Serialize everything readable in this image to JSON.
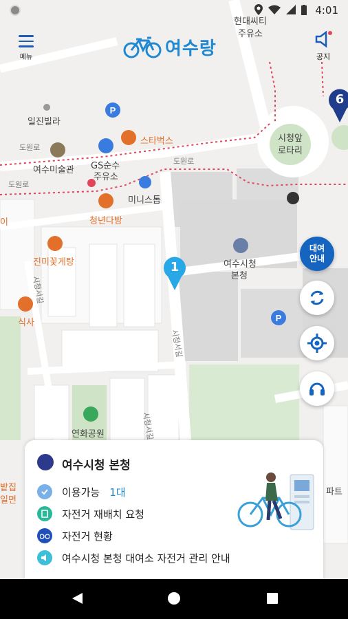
{
  "status_bar": {
    "time": "4:01"
  },
  "header": {
    "menu_label": "메뉴",
    "logo_text": "여수랑",
    "notice_label": "공지"
  },
  "map": {
    "labels": [
      {
        "id": "hyundai",
        "text": "현대씨티"
      },
      {
        "id": "juyuso1",
        "text": "주유소"
      },
      {
        "id": "ilgin",
        "text": "일진빌라"
      },
      {
        "id": "dowonro1",
        "text": "도원로"
      },
      {
        "id": "starbucks",
        "text": "스타벅스"
      },
      {
        "id": "yeosu-art",
        "text": "여수미술관"
      },
      {
        "id": "gs1",
        "text": "GS순수"
      },
      {
        "id": "gs2",
        "text": "주유소"
      },
      {
        "id": "dowonro2",
        "text": "도원로"
      },
      {
        "id": "dowonro3",
        "text": "도원로"
      },
      {
        "id": "ministop",
        "text": "미니스톱"
      },
      {
        "id": "cheongnyeon",
        "text": "청년다방"
      },
      {
        "id": "jinmi",
        "text": "진미꽃게탕"
      },
      {
        "id": "sikan",
        "text": "식사"
      },
      {
        "id": "cityhall",
        "text": "여수시청"
      },
      {
        "id": "cityhall2",
        "text": "본청"
      },
      {
        "id": "rotary1",
        "text": "시청앞"
      },
      {
        "id": "rotary2",
        "text": "로타리"
      },
      {
        "id": "sicheong-gil-a",
        "text": "시청서길"
      },
      {
        "id": "sicheong-gil-b",
        "text": "시청서길"
      },
      {
        "id": "sicheong-gil-c",
        "text": "시청서길"
      },
      {
        "id": "yeonhwa",
        "text": "연화공원"
      },
      {
        "id": "i-left",
        "text": "이"
      },
      {
        "id": "park-left",
        "text": "밭집"
      },
      {
        "id": "park-left2",
        "text": "일면"
      },
      {
        "id": "apart",
        "text": "파트"
      }
    ],
    "pins": [
      {
        "id": "pin-1",
        "text": "1"
      },
      {
        "id": "pin-6",
        "text": "6"
      }
    ]
  },
  "fabs": {
    "rental_guide": "대여\n안내"
  },
  "card": {
    "title": "여수시청 본청",
    "available_label": "이용가능",
    "available_count": "1대",
    "relocate_label": "자전거 재배치 요청",
    "status_label": "자전거 현황",
    "notice_label": "여수시청 본청 대여소 자전거 관리 안내"
  },
  "colors": {
    "accent": "#1e88d2",
    "primary_blue": "#1565c0",
    "route_red": "#e0455a",
    "orange_poi": "#e3702a"
  }
}
